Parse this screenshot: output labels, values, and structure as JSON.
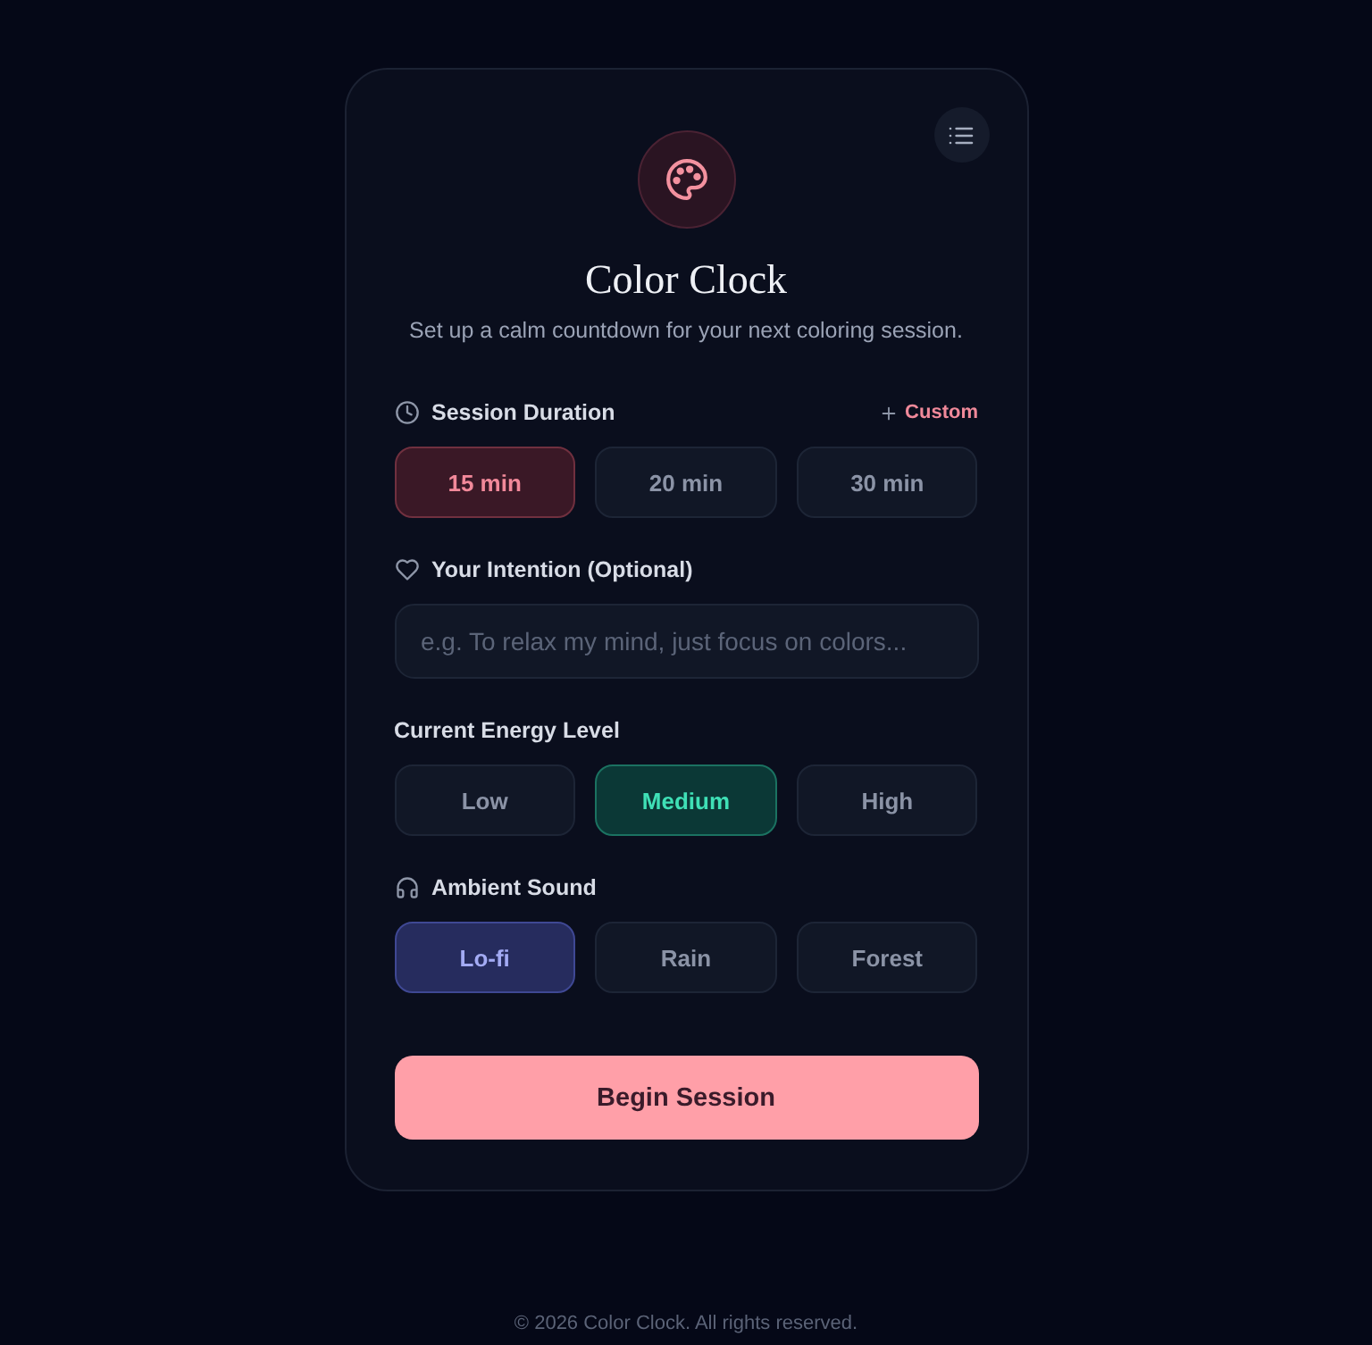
{
  "header": {
    "title": "Color Clock",
    "subtitle": "Set up a calm countdown for your next coloring session."
  },
  "session_duration": {
    "label": "Session Duration",
    "custom_link": "Custom",
    "options": [
      {
        "label": "15 min",
        "selected": true
      },
      {
        "label": "20 min",
        "selected": false
      },
      {
        "label": "30 min",
        "selected": false
      }
    ]
  },
  "intention": {
    "label": "Your Intention (Optional)",
    "placeholder": "e.g. To relax my mind, just focus on colors..."
  },
  "energy_level": {
    "label": "Current Energy Level",
    "options": [
      {
        "label": "Low",
        "selected": false
      },
      {
        "label": "Medium",
        "selected": true
      },
      {
        "label": "High",
        "selected": false
      }
    ]
  },
  "ambient_sound": {
    "label": "Ambient Sound",
    "options": [
      {
        "label": "Lo-fi",
        "selected": true
      },
      {
        "label": "Rain",
        "selected": false
      },
      {
        "label": "Forest",
        "selected": false
      }
    ]
  },
  "begin_button": "Begin Session",
  "footer": "© 2026 Color Clock. All rights reserved."
}
